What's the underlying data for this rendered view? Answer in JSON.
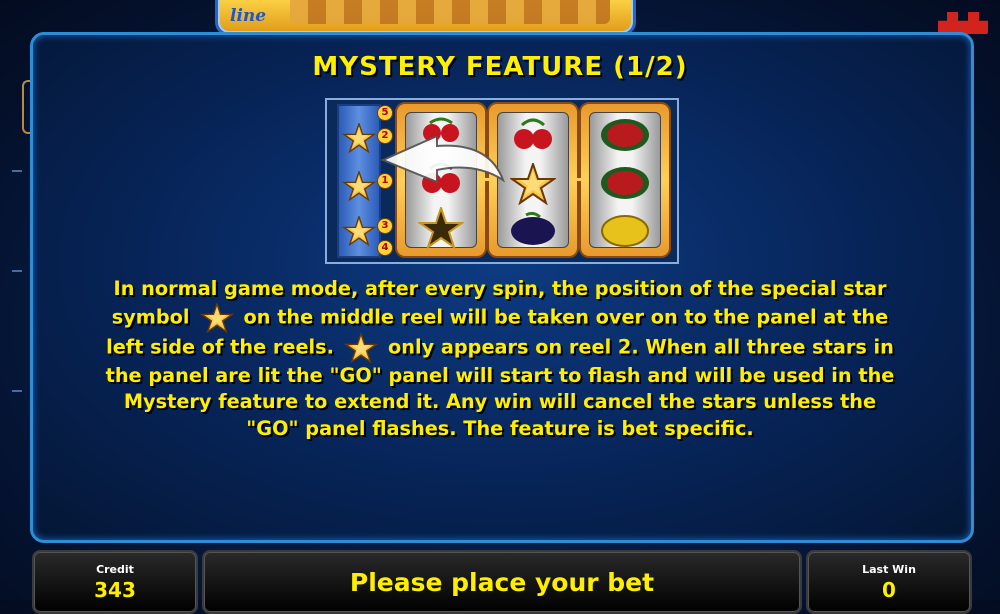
{
  "title": "MYSTERY FEATURE (1/2)",
  "description_lines": [
    "In normal game mode, after every spin, the position of the special star",
    "on the middle reel will be taken over on to the panel at the",
    "left side of the reels.",
    "only appears on reel 2. When all three stars in",
    "the panel are lit the \"GO\" panel will start to flash and will be used in the",
    "Mystery feature to extend it. Any win will cancel the stars unless the",
    "\"GO\" panel flashes. The feature is bet specific."
  ],
  "description_word_symbol": "symbol",
  "panel_numbers": [
    "5",
    "2",
    "1",
    "3",
    "4"
  ],
  "icons": [
    "star-symbol-icon",
    "cherry-icon",
    "melon-icon",
    "plum-icon",
    "lemon-icon",
    "arrow-icon"
  ],
  "colors": {
    "text": "#ffee00",
    "panel_border": "#2f8dd6",
    "background": "#061a40"
  },
  "bottom": {
    "credit_label": "Credit",
    "credit_value": "343",
    "message": "Please place your bet",
    "lastwin_label": "Last Win",
    "lastwin_value": "0"
  }
}
